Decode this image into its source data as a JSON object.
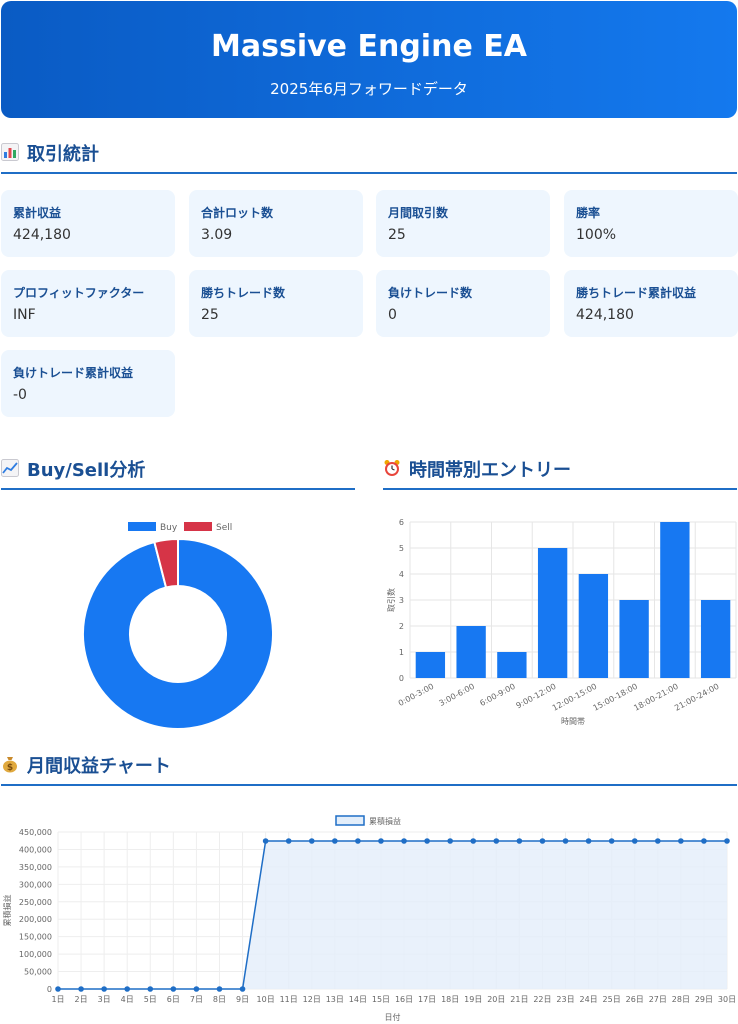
{
  "header": {
    "title": "Massive Engine EA",
    "subtitle": "2025年6月フォワードデータ"
  },
  "sections": {
    "stats": "取引統計",
    "buysell": "Buy/Sell分析",
    "hourly": "時間帯別エントリー",
    "monthly": "月間収益チャート"
  },
  "icons": {
    "stats": "bar-chart-icon",
    "buysell": "trend-chart-icon",
    "hourly": "alarm-clock-icon",
    "monthly": "money-bag-icon"
  },
  "stats": [
    {
      "label": "累計収益",
      "value": "424,180"
    },
    {
      "label": "合計ロット数",
      "value": "3.09"
    },
    {
      "label": "月間取引数",
      "value": "25"
    },
    {
      "label": "勝率",
      "value": "100%"
    },
    {
      "label": "プロフィットファクター",
      "value": "INF"
    },
    {
      "label": "勝ちトレード数",
      "value": "25"
    },
    {
      "label": "負けトレード数",
      "value": "0"
    },
    {
      "label": "勝ちトレード累計収益",
      "value": "424,180"
    },
    {
      "label": "負けトレード累計収益",
      "value": "-0"
    }
  ],
  "colors": {
    "buy": "#1778f2",
    "sell": "#d63447",
    "line": "#1f6ec6",
    "fill": "#e3eefa"
  },
  "chart_data": [
    {
      "type": "pie",
      "style": "doughnut",
      "categories": [
        "Buy",
        "Sell"
      ],
      "values": [
        24,
        1
      ],
      "legend": "top"
    },
    {
      "type": "bar",
      "categories": [
        "0:00-3:00",
        "3:00-6:00",
        "6:00-9:00",
        "9:00-12:00",
        "12:00-15:00",
        "15:00-18:00",
        "18:00-21:00",
        "21:00-24:00"
      ],
      "values": [
        1,
        2,
        1,
        5,
        4,
        3,
        6,
        3
      ],
      "xlabel": "時間帯",
      "ylabel": "取引数",
      "ylim": [
        0,
        6
      ],
      "yticks": [
        0,
        1,
        2,
        3,
        4,
        5,
        6
      ],
      "grid": true
    },
    {
      "type": "area",
      "x": [
        "1日",
        "2日",
        "3日",
        "4日",
        "5日",
        "6日",
        "7日",
        "8日",
        "9日",
        "10日",
        "11日",
        "12日",
        "13日",
        "14日",
        "15日",
        "16日",
        "17日",
        "18日",
        "19日",
        "20日",
        "21日",
        "22日",
        "23日",
        "24日",
        "25日",
        "26日",
        "27日",
        "28日",
        "29日",
        "30日"
      ],
      "series": [
        {
          "name": "累積損益",
          "values": [
            0,
            0,
            0,
            0,
            0,
            0,
            0,
            0,
            0,
            424180,
            424180,
            424180,
            424180,
            424180,
            424180,
            424180,
            424180,
            424180,
            424180,
            424180,
            424180,
            424180,
            424180,
            424180,
            424180,
            424180,
            424180,
            424180,
            424180,
            424180
          ]
        }
      ],
      "xlabel": "日付",
      "ylabel": "累積損益",
      "ylim": [
        0,
        450000
      ],
      "yticks": [
        "0",
        "50,000",
        "100,000",
        "150,000",
        "200,000",
        "250,000",
        "300,000",
        "350,000",
        "400,000",
        "450,000"
      ],
      "legend": "top",
      "grid": true
    }
  ]
}
